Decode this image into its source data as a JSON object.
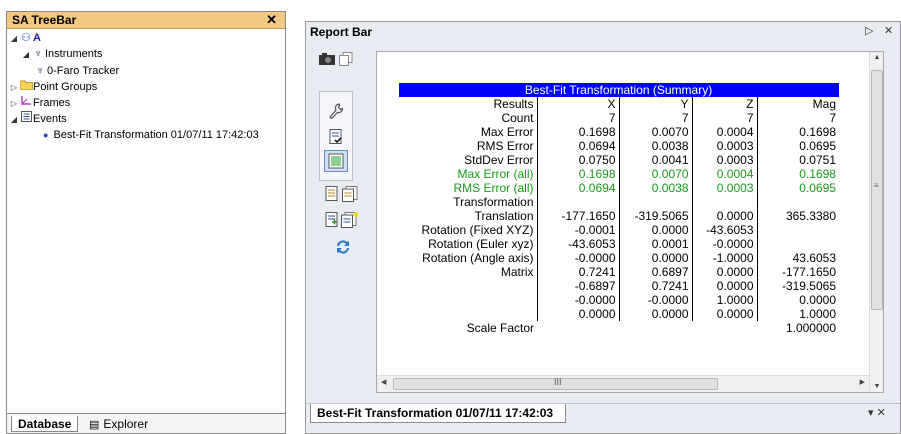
{
  "tree": {
    "title": "SA TreeBar",
    "close_label": "✕",
    "root": "A",
    "instruments": "Instruments",
    "tracker": "0-Faro Tracker",
    "point_groups": "Point Groups",
    "frames": "Frames",
    "events": "Events",
    "event_item": "Best-Fit Transformation 01/07/11 17:42:03",
    "tab_database": "Database",
    "tab_explorer": "Explorer"
  },
  "report": {
    "title": "Report Bar",
    "pin_label": "▷",
    "close_label": "✕",
    "tab_label": "Best-Fit Transformation 01/07/11 17:42:03",
    "tab_controls": "▾ ✕",
    "table_title": "Best-Fit Transformation (Summary)",
    "grip": "III",
    "rows": [
      {
        "label": "Results",
        "c1": "X",
        "c2": "Y",
        "c3": "Z",
        "c4": "Mag"
      },
      {
        "label": "Count",
        "c1": "7",
        "c2": "7",
        "c3": "7",
        "c4": "7"
      },
      {
        "label": "Max Error",
        "c1": "0.1698",
        "c2": "0.0070",
        "c3": "0.0004",
        "c4": "0.1698"
      },
      {
        "label": "RMS Error",
        "c1": "0.0694",
        "c2": "0.0038",
        "c3": "0.0003",
        "c4": "0.0695"
      },
      {
        "label": "StdDev Error",
        "c1": "0.0750",
        "c2": "0.0041",
        "c3": "0.0003",
        "c4": "0.0751"
      },
      {
        "label": "Max Error (all)",
        "c1": "0.1698",
        "c2": "0.0070",
        "c3": "0.0004",
        "c4": "0.1698",
        "green": true
      },
      {
        "label": "RMS Error (all)",
        "c1": "0.0694",
        "c2": "0.0038",
        "c3": "0.0003",
        "c4": "0.0695",
        "green": true
      },
      {
        "label": "Transformation",
        "c1": "",
        "c2": "",
        "c3": "",
        "c4": ""
      },
      {
        "label": "Translation",
        "c1": "-177.1650",
        "c2": "-319.5065",
        "c3": "0.0000",
        "c4": "365.3380"
      },
      {
        "label": "Rotation (Fixed XYZ)",
        "c1": "-0.0001",
        "c2": "0.0000",
        "c3": "-43.6053",
        "c4": ""
      },
      {
        "label": "Rotation (Euler xyz)",
        "c1": "-43.6053",
        "c2": "0.0001",
        "c3": "-0.0000",
        "c4": ""
      },
      {
        "label": "Rotation (Angle axis)",
        "c1": "-0.0000",
        "c2": "0.0000",
        "c3": "-1.0000",
        "c4": "43.6053"
      },
      {
        "label": "Matrix",
        "c1": "0.7241",
        "c2": "0.6897",
        "c3": "0.0000",
        "c4": "-177.1650"
      },
      {
        "label": "",
        "c1": "-0.6897",
        "c2": "0.7241",
        "c3": "0.0000",
        "c4": "-319.5065"
      },
      {
        "label": "",
        "c1": "-0.0000",
        "c2": "-0.0000",
        "c3": "1.0000",
        "c4": "0.0000"
      },
      {
        "label": "",
        "c1": "0.0000",
        "c2": "0.0000",
        "c3": "0.0000",
        "c4": "1.0000"
      },
      {
        "label": "Scale Factor",
        "c1": "",
        "c2": "",
        "c3": "",
        "c4": "1.000000"
      }
    ]
  },
  "colors": {
    "tree_title_bg": "#f2c983",
    "table_header_bg": "#0000ff",
    "green_rows": "#1a9a1a"
  }
}
